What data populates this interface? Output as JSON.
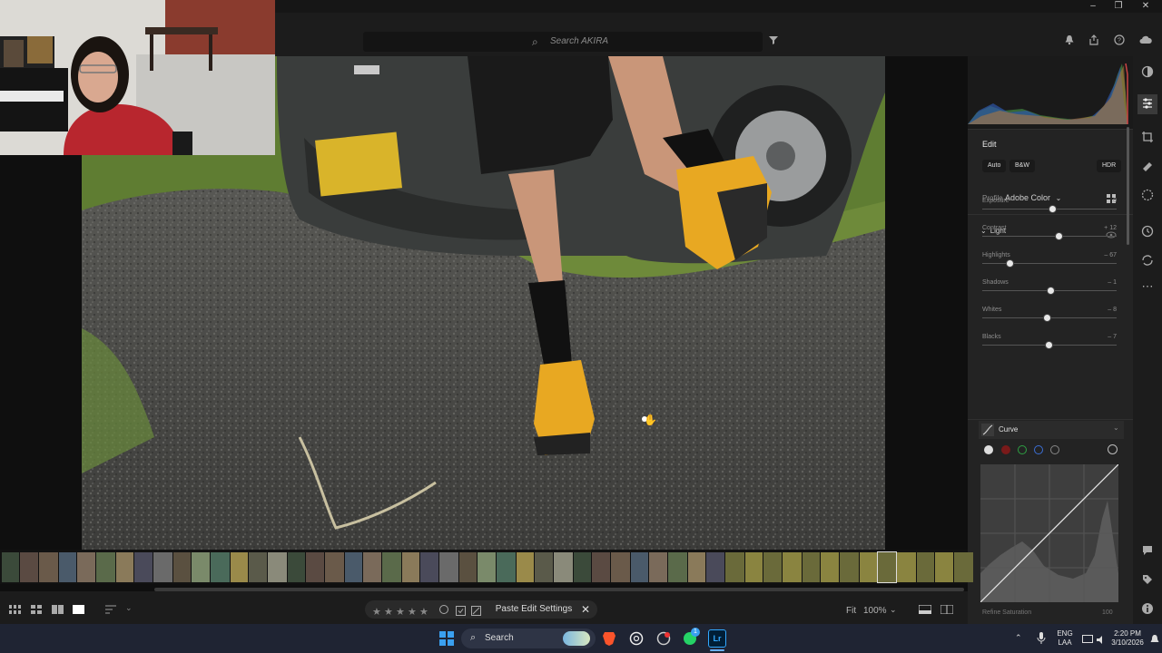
{
  "app": {
    "search_placeholder": "Search AKIRA"
  },
  "window_controls": {
    "minimize": "–",
    "restore": "❐",
    "close": "✕"
  },
  "edit_panel": {
    "title": "Edit",
    "auto_label": "Auto",
    "bw_label": "B&W",
    "hdr_label": "HDR",
    "profile_label": "Profile",
    "profile_value": "Adobe Color",
    "light_section": "Light",
    "sliders": [
      {
        "label": "Exposure",
        "value": "0",
        "position": 0.52
      },
      {
        "label": "Contrast",
        "value": "+ 12",
        "position": 0.57
      },
      {
        "label": "Highlights",
        "value": "– 67",
        "position": 0.2
      },
      {
        "label": "Shadows",
        "value": "– 1",
        "position": 0.51
      },
      {
        "label": "Whites",
        "value": "– 8",
        "position": 0.48
      },
      {
        "label": "Blacks",
        "value": "– 7",
        "position": 0.49
      }
    ],
    "curve_section": "Curve",
    "refine_saturation": "Refine Saturation",
    "refine_value": "100"
  },
  "bottom_toolbar": {
    "paste_edit_settings": "Paste Edit Settings",
    "fit_label": "Fit",
    "zoom_value": "100%"
  },
  "taskbar": {
    "search_label": "Search",
    "lang_top": "ENG",
    "lang_bottom": "LAA",
    "time": "2:20 PM",
    "date": "3/10/2026",
    "whatsapp_badge": "1"
  },
  "colors": {
    "panel_bg": "#232323",
    "accent_yellow": "#e8a822",
    "taskbar_bg": "#1f2433"
  }
}
